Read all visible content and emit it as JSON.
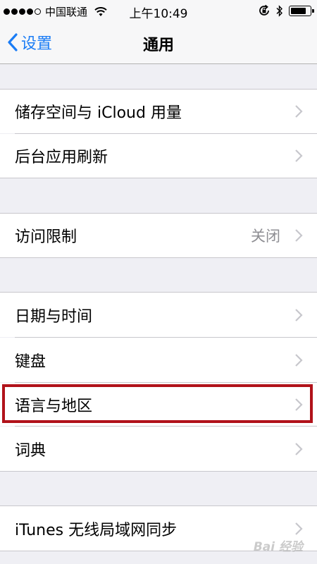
{
  "status_bar": {
    "carrier": "中国联通",
    "time": "上午10:49",
    "battery_level": 0.85
  },
  "nav": {
    "back_label": "设置",
    "title": "通用"
  },
  "groups": [
    {
      "items": [
        {
          "label": "储存空间与 iCloud 用量"
        },
        {
          "label": "后台应用刷新"
        }
      ]
    },
    {
      "items": [
        {
          "label": "访问限制",
          "value": "关闭"
        }
      ]
    },
    {
      "items": [
        {
          "label": "日期与时间"
        },
        {
          "label": "键盘"
        },
        {
          "label": "语言与地区",
          "highlighted": true
        },
        {
          "label": "词典"
        }
      ]
    },
    {
      "items": [
        {
          "label": "iTunes 无线局域网同步"
        }
      ]
    }
  ],
  "watermark": "Bai 经验",
  "colors": {
    "accent": "#1a7cf5",
    "highlight_border": "#b1121a",
    "background": "#efeff4",
    "chevron": "#c7c7cc"
  }
}
